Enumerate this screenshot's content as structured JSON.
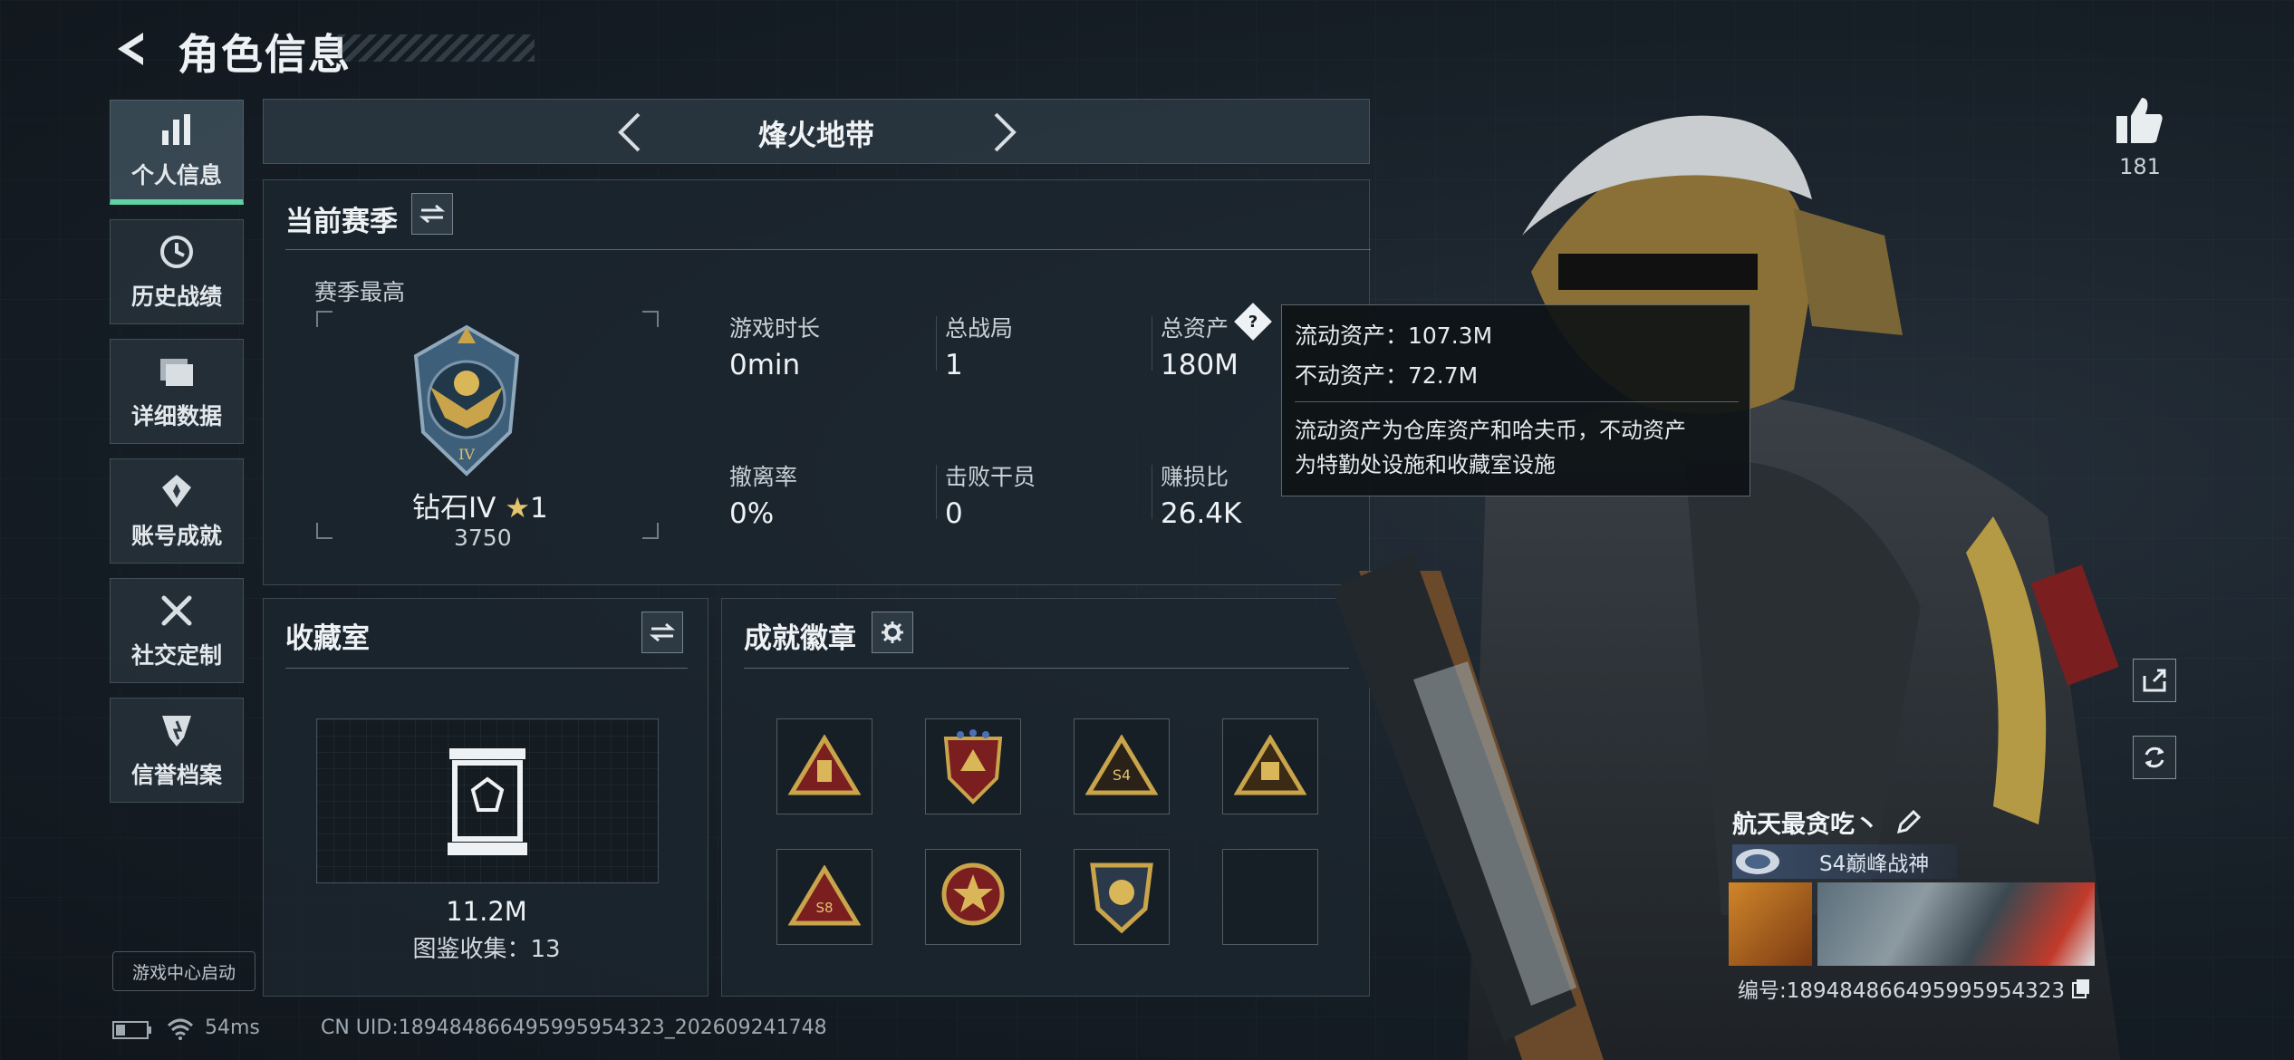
{
  "header": {
    "title": "角色信息"
  },
  "sidebar": {
    "items": [
      {
        "label": "个人信息",
        "icon": "bar-chart-icon",
        "active": true
      },
      {
        "label": "历史战绩",
        "icon": "clock-icon"
      },
      {
        "label": "详细数据",
        "icon": "folder-icon"
      },
      {
        "label": "账号成就",
        "icon": "achievement-icon"
      },
      {
        "label": "社交定制",
        "icon": "tools-icon"
      },
      {
        "label": "信誉档案",
        "icon": "shield-icon"
      }
    ],
    "game_center": "游戏中心启动"
  },
  "mode": {
    "name": "烽火地带"
  },
  "season": {
    "title": "当前赛季",
    "best_label": "赛季最高",
    "rank": "钻石IV",
    "stars": "1",
    "score": "3750",
    "stats": [
      {
        "label": "游戏时长",
        "value": "0min"
      },
      {
        "label": "总战局",
        "value": "1"
      },
      {
        "label": "总资产",
        "value": "180M"
      },
      {
        "label": "撤离率",
        "value": "0%"
      },
      {
        "label": "击败干员",
        "value": "0"
      },
      {
        "label": "赚损比",
        "value": "26.4K"
      }
    ]
  },
  "tooltip": {
    "liquid": "流动资产：107.3M",
    "fixed": "不动资产：72.7M",
    "desc_line1": "流动资产为仓库资产和哈夫币，不动资产",
    "desc_line2": "为特勤处设施和收藏室设施"
  },
  "collection": {
    "title": "收藏室",
    "value": "11.2M",
    "count": "图鉴收集：13"
  },
  "badges": {
    "title": "成就徽章",
    "labels": [
      "S4",
      "S8"
    ]
  },
  "profile": {
    "likes": "181",
    "name": "航天最贪吃丶",
    "title_badge": "S4巅峰战神",
    "id": "编号:189484866495995954323"
  },
  "footer": {
    "ping": "54ms",
    "uid": "CN UID:189484866495995954323_202609241748"
  },
  "colors": {
    "accent": "#5fd3a2",
    "gold": "#c9a44a",
    "panel": "#1c262f"
  }
}
